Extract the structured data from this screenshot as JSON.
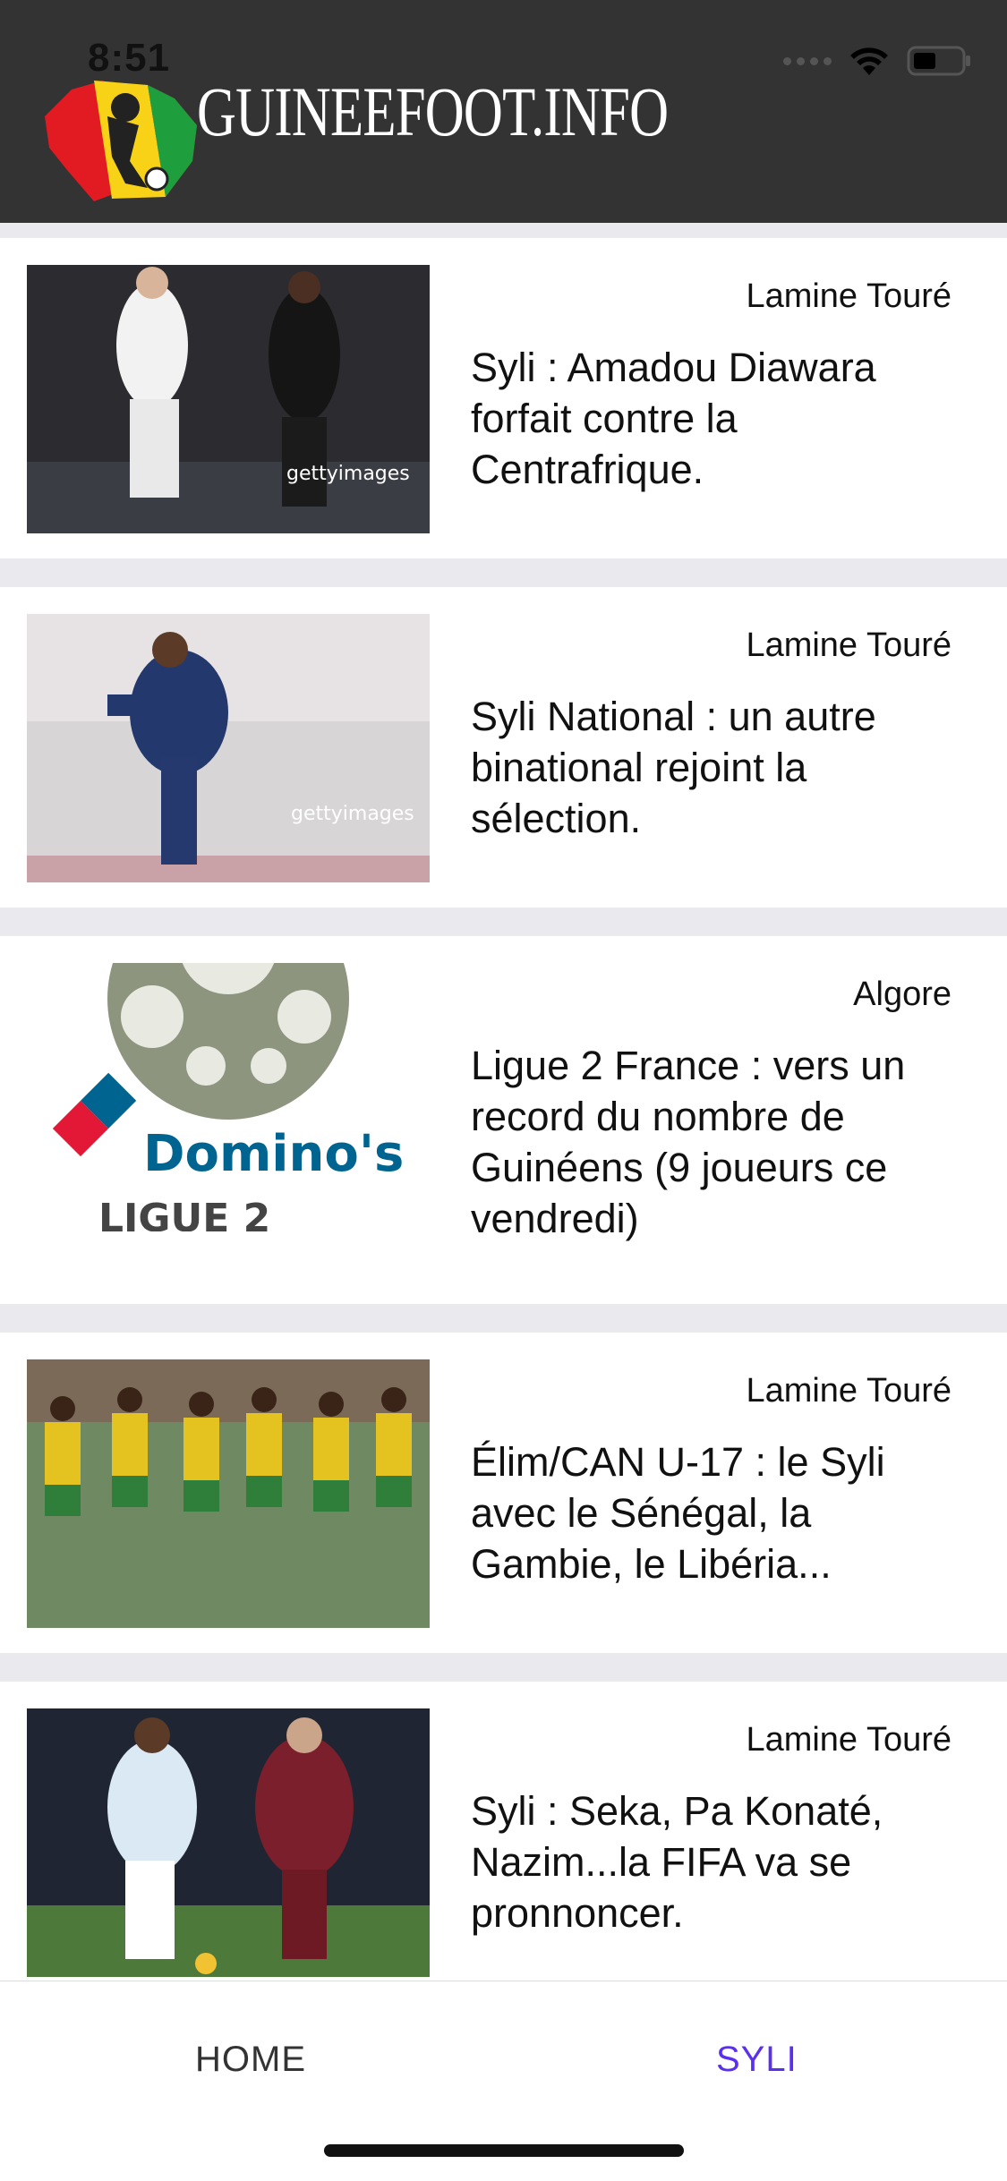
{
  "status_bar": {
    "time": "8:51"
  },
  "header": {
    "logo_text": "GUINEEFOOT.INFO"
  },
  "articles": [
    {
      "author": "Lamine Touré",
      "title": "Syli : Amadou Diawara forfait contre la Centrafrique."
    },
    {
      "author": "Lamine Touré",
      "title": "Syli National : un autre binational rejoint la sélection."
    },
    {
      "author": "Algore",
      "title": "Ligue 2 France : vers un record du nombre de Guinéens (9 joueurs ce vendredi)"
    },
    {
      "author": "Lamine Touré",
      "title": "Élim/CAN U-17 : le Syli avec le Sénégal, la Gambie, le Libéria..."
    },
    {
      "author": "Lamine Touré",
      "title": "Syli : Seka, Pa Konaté, Nazim...la FIFA va se pronnoncer."
    }
  ],
  "tabbar": {
    "home_label": "HOME",
    "syli_label": "SYLI",
    "active_color": "#5b2ff0"
  }
}
